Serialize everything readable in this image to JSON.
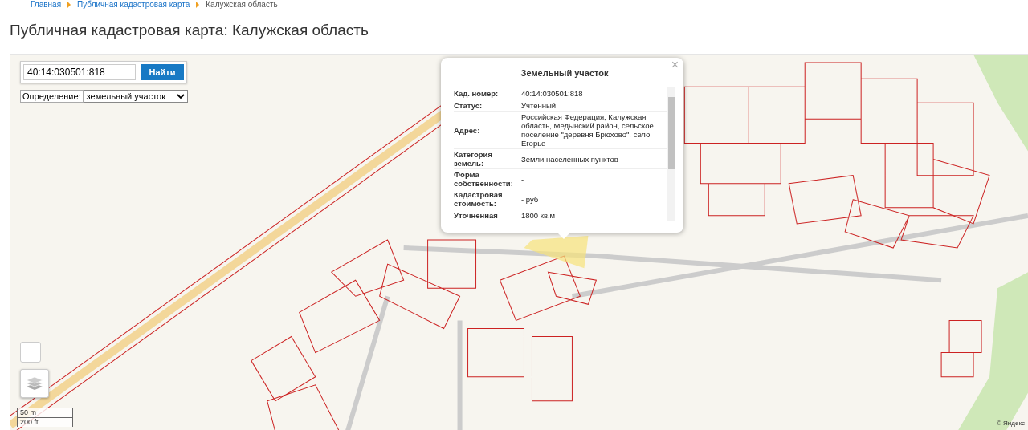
{
  "breadcrumbs": [
    {
      "label": "Главная",
      "kind": "link"
    },
    {
      "label": "Публичная кадастровая карта",
      "kind": "link"
    },
    {
      "label": "Калужская область",
      "kind": "current"
    }
  ],
  "title": "Публичная кадастровая карта: Калужская область",
  "search": {
    "value": "40:14:030501:818",
    "button": "Найти"
  },
  "definition": {
    "label": "Определение:",
    "value": "земельный участок"
  },
  "popup": {
    "title": "Земельный участок",
    "close": "×",
    "rows": [
      {
        "label": "Кад. номер:",
        "value": "40:14:030501:818"
      },
      {
        "label": "Статус:",
        "value": "Учтенный"
      },
      {
        "label": "Адрес:",
        "value": "Российская Федерация, Калужская область, Медынский район, сельское поселение \"деревня Брюхово\", село Егорье"
      },
      {
        "label": "Категория земель:",
        "value": "Земли населенных пунктов"
      },
      {
        "label": "Форма собственности:",
        "value": "-"
      },
      {
        "label": "Кадастровая стоимость:",
        "value": "- руб"
      },
      {
        "label": "Уточненная",
        "value": "1800 кв.м"
      }
    ]
  },
  "scale": {
    "metric": "50 m",
    "imperial": "200 ft"
  },
  "copyright": "© Яндекс"
}
